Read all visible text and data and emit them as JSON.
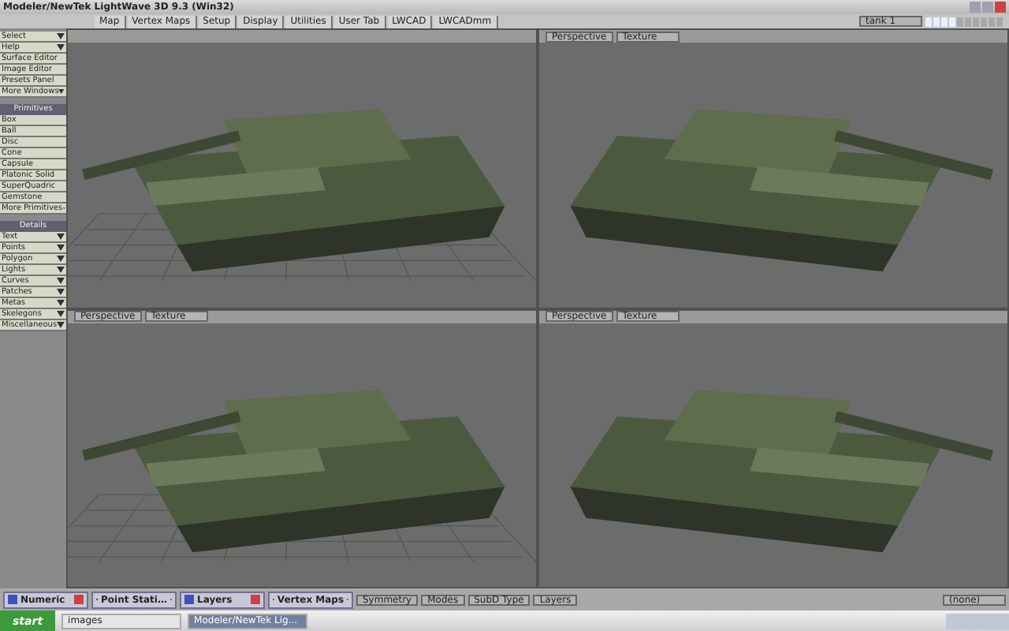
{
  "window": {
    "title": "Modeler/NewTek LightWave 3D 9.3 (Win32)"
  },
  "tabs": [
    {
      "label": "Map"
    },
    {
      "label": "Vertex Maps"
    },
    {
      "label": "Setup"
    },
    {
      "label": "Display"
    },
    {
      "label": "Utilities"
    },
    {
      "label": "User Tab"
    },
    {
      "label": "LWCAD"
    },
    {
      "label": "LWCADmm"
    }
  ],
  "layer_selector": {
    "value": "tank 1"
  },
  "sidebar": {
    "items": [
      {
        "kind": "dropdown",
        "label": "Select"
      },
      {
        "kind": "dropdown",
        "label": "Help"
      },
      {
        "kind": "button",
        "label": "Surface Editor"
      },
      {
        "kind": "button",
        "label": "Image Editor"
      },
      {
        "kind": "button",
        "label": "Presets Panel"
      },
      {
        "kind": "dropdown",
        "label": "More Windows"
      },
      {
        "kind": "header",
        "label": "Primitives"
      },
      {
        "kind": "button",
        "label": "Box"
      },
      {
        "kind": "button",
        "label": "Ball"
      },
      {
        "kind": "button",
        "label": "Disc"
      },
      {
        "kind": "button",
        "label": "Cone"
      },
      {
        "kind": "button",
        "label": "Capsule"
      },
      {
        "kind": "button",
        "label": "Platonic Solid"
      },
      {
        "kind": "button",
        "label": "SuperQuadric"
      },
      {
        "kind": "button",
        "label": "Gemstone"
      },
      {
        "kind": "dropdown",
        "label": "More Primitives"
      },
      {
        "kind": "header",
        "label": "Details"
      },
      {
        "kind": "dropdown",
        "label": "Text"
      },
      {
        "kind": "dropdown",
        "label": "Points"
      },
      {
        "kind": "dropdown",
        "label": "Polygon"
      },
      {
        "kind": "dropdown",
        "label": "Lights"
      },
      {
        "kind": "dropdown",
        "label": "Curves"
      },
      {
        "kind": "dropdown",
        "label": "Patches"
      },
      {
        "kind": "dropdown",
        "label": "Metas"
      },
      {
        "kind": "dropdown",
        "label": "Skelegons"
      },
      {
        "kind": "dropdown",
        "label": "Miscellaneous"
      }
    ]
  },
  "viewports": [
    {
      "grid": true
    },
    {
      "view": "Perspective",
      "mode": "Texture",
      "grid": false
    },
    {
      "view": "Perspective",
      "mode": "Texture",
      "grid": true
    },
    {
      "view": "Perspective",
      "mode": "Texture",
      "grid": false
    }
  ],
  "floating_panels": [
    {
      "title": "Numeric"
    },
    {
      "title": "Point Stati…"
    },
    {
      "title": "Layers"
    },
    {
      "title": "Vertex Maps"
    }
  ],
  "bottom_bar": {
    "symmetry": "Symmetry",
    "modes": "Modes",
    "subd_type": "SubD Type",
    "layers": "Layers",
    "vmap": "(none)"
  },
  "taskbar": {
    "start": "start",
    "items": [
      {
        "label": "images",
        "selected": false
      },
      {
        "label": "Modeler/NewTek Lig...",
        "selected": true
      }
    ]
  }
}
